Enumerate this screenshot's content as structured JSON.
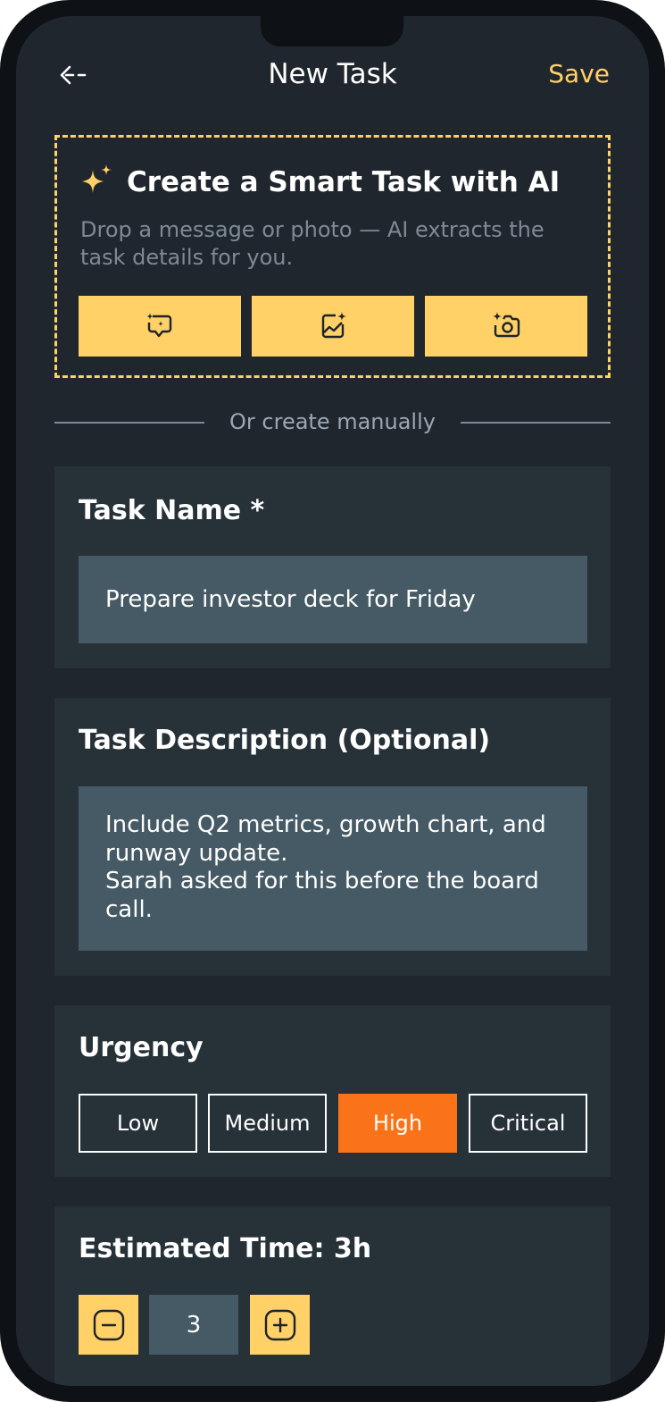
{
  "header": {
    "back_icon": "arrow-left-icon",
    "title": "New Task",
    "save_label": "Save"
  },
  "ai_card": {
    "icon": "sparkle-icon",
    "title": "Create a Smart Task with AI",
    "description": "Drop a message or photo — AI extracts the task details for you.",
    "buttons": [
      {
        "icon": "ai-message-icon"
      },
      {
        "icon": "ai-image-icon"
      },
      {
        "icon": "ai-camera-icon"
      }
    ]
  },
  "divider_text": "Or create manually",
  "task_name": {
    "label": "Task Name *",
    "value": "Prepare investor deck for Friday"
  },
  "task_description": {
    "label": "Task Description (Optional)",
    "value": "Include Q2 metrics, growth chart, and runway update.\nSarah asked for this before the board call."
  },
  "urgency": {
    "label": "Urgency",
    "options": [
      "Low",
      "Medium",
      "High",
      "Critical"
    ],
    "selected": "High"
  },
  "estimated_time": {
    "label": "Estimated Time: 3h",
    "value": "3",
    "decrement_icon": "minus-icon",
    "increment_icon": "plus-icon"
  },
  "colors": {
    "accent": "#ffd166",
    "selected": "#fb7318",
    "background": "#20262d",
    "card": "#263138",
    "field": "#455a64"
  }
}
